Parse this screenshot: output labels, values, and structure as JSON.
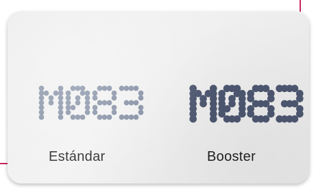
{
  "samples": [
    {
      "code": "M083",
      "label": "Estándar",
      "dot_color": "#7e8aa0",
      "dot_radius_unit": 0.55
    },
    {
      "code": "M083",
      "label": "Booster",
      "dot_color": "#4d5770",
      "dot_radius_unit": 0.72
    }
  ],
  "colors": {
    "accent": "#c8265a",
    "card": "#eeeeee"
  }
}
